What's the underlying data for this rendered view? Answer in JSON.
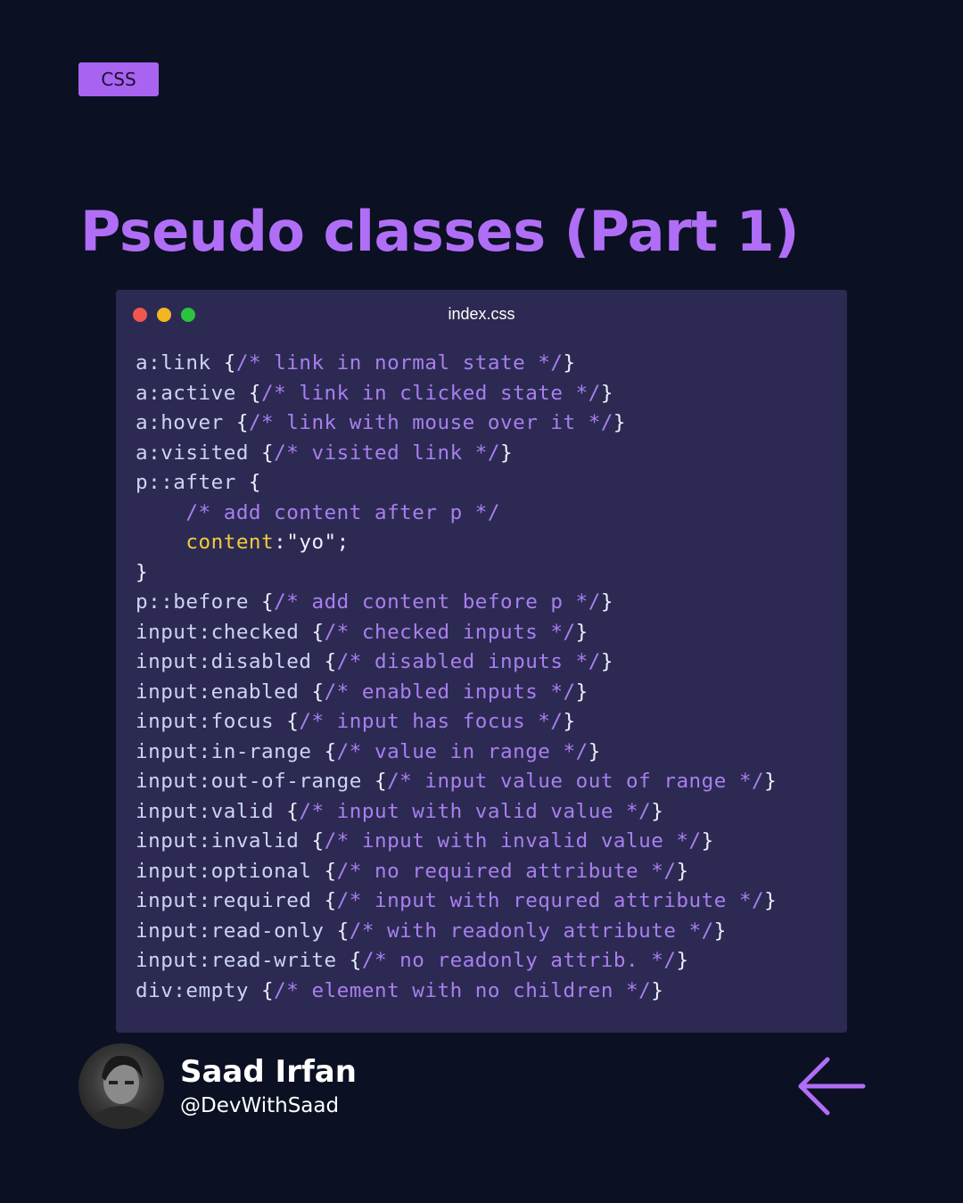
{
  "tag": {
    "label": "CSS"
  },
  "title": "Pseudo classes (Part 1)",
  "window": {
    "filename": "index.css",
    "lines": [
      {
        "selector": "a:link",
        "comment": "/* link in normal state */"
      },
      {
        "selector": "a:active",
        "comment": "/* link in clicked state */"
      },
      {
        "selector": "a:hover",
        "comment": "/* link with mouse over it */"
      },
      {
        "selector": "a:visited",
        "comment": "/* visited link */"
      },
      {
        "selector": "p::after",
        "open_block": true
      },
      {
        "indent_comment": "/* add content after p */"
      },
      {
        "property": "content",
        "value": "\"yo\""
      },
      {
        "close_block": true
      },
      {
        "selector": "p::before",
        "comment": "/* add content before p */"
      },
      {
        "selector": "input:checked",
        "comment": "/* checked inputs */"
      },
      {
        "selector": "input:disabled",
        "comment": "/* disabled inputs */"
      },
      {
        "selector": "input:enabled",
        "comment": "/* enabled inputs */"
      },
      {
        "selector": "input:focus",
        "comment": "/* input has focus */"
      },
      {
        "selector": "input:in-range",
        "comment": "/* value in range */"
      },
      {
        "selector": "input:out-of-range",
        "comment": "/* input value out of range */"
      },
      {
        "selector": "input:valid",
        "comment": "/* input with valid value */"
      },
      {
        "selector": "input:invalid",
        "comment": "/* input with invalid value */"
      },
      {
        "selector": "input:optional",
        "comment": "/* no required attribute */"
      },
      {
        "selector": "input:required",
        "comment": "/* input with requred attribute */"
      },
      {
        "selector": "input:read-only",
        "comment": "/* with readonly attribute */"
      },
      {
        "selector": "input:read-write",
        "comment": "/* no readonly attrib. */"
      },
      {
        "selector": "div:empty",
        "comment": "/* element with no children */"
      }
    ]
  },
  "author": {
    "name": "Saad Irfan",
    "handle": "@DevWithSaad"
  },
  "navigation": {
    "back_icon": "arrow-left-icon"
  },
  "colors": {
    "background": "#0b1122",
    "accent": "#b06ef6",
    "tag_background": "#a863f0",
    "editor_background": "#2c2a52",
    "comment": "#a97ff0",
    "selector": "#cdd3f7",
    "property": "#f2cd3c",
    "window_red": "#f2564f",
    "window_yellow": "#f3b623",
    "window_green": "#2cc23e"
  }
}
